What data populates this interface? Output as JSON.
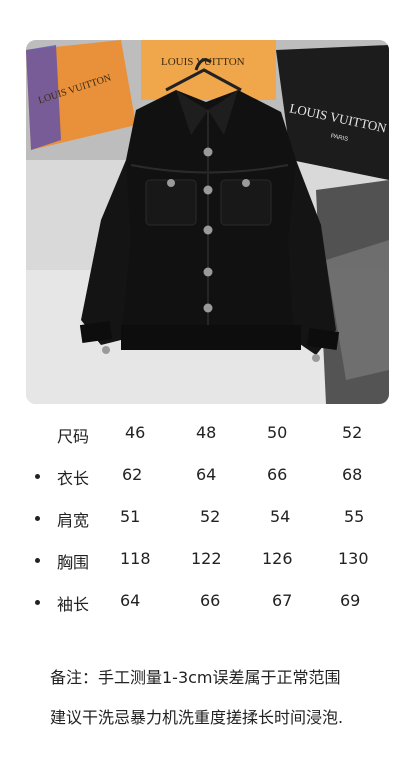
{
  "photo": {
    "bag_text_left": "LOUIS VUITTON",
    "bag_text_center": "LOUIS VUITTON",
    "bag_text_right": "LOUIS VUITTON",
    "bag_text_right_sub": "PARIS"
  },
  "size_table": {
    "header": {
      "label": "尺码",
      "values": [
        "46",
        "48",
        "50",
        "52"
      ]
    },
    "rows": [
      {
        "label": "衣长",
        "values": [
          "62",
          "64",
          "66",
          "68"
        ]
      },
      {
        "label": "肩宽",
        "values": [
          "51",
          "52",
          "54",
          "55"
        ]
      },
      {
        "label": "胸围",
        "values": [
          "118",
          "122",
          "126",
          "130"
        ]
      },
      {
        "label": "袖长",
        "values": [
          "64",
          "66",
          "67",
          "69"
        ]
      }
    ]
  },
  "notes": {
    "line1": "备注：手工测量1-3cm误差属于正常范围",
    "line2": "建议干洗忌暴力机洗重度搓揉长时间浸泡."
  }
}
